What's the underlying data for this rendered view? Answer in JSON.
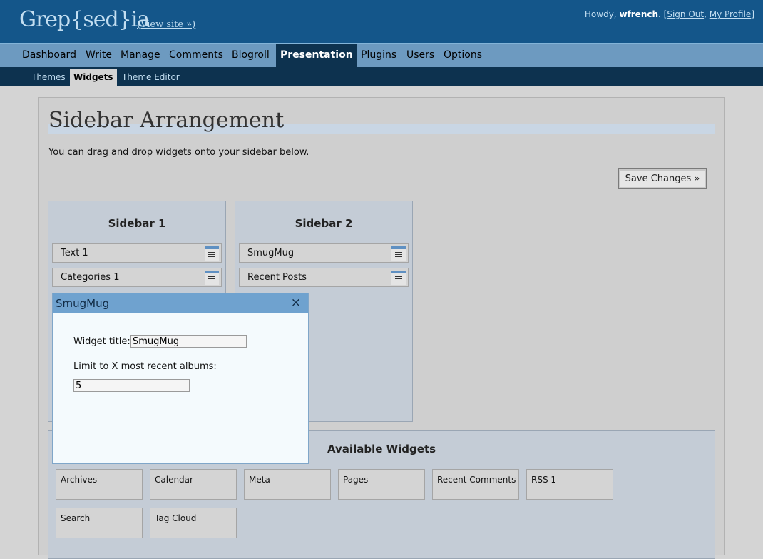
{
  "header": {
    "blog_title": "Grep{sed}ia",
    "view_site": "(View site »)",
    "howdy": "Howdy,",
    "username": "wfrench",
    "sign_out": "Sign Out",
    "my_profile": "My Profile"
  },
  "nav": {
    "items": [
      "Dashboard",
      "Write",
      "Manage",
      "Comments",
      "Blogroll",
      "Presentation",
      "Plugins",
      "Users",
      "Options"
    ],
    "current": "Presentation"
  },
  "subnav": {
    "items": [
      "Themes",
      "Widgets",
      "Theme Editor"
    ],
    "current": "Widgets"
  },
  "main": {
    "title": "Sidebar Arrangement",
    "intro": "You can drag and drop widgets onto your sidebar below.",
    "save_label": "Save Changes »"
  },
  "sidebar1": {
    "title": "Sidebar 1",
    "widgets": [
      "Text 1",
      "Categories 1"
    ]
  },
  "sidebar2": {
    "title": "Sidebar 2",
    "widgets": [
      "SmugMug",
      "Recent Posts"
    ]
  },
  "available": {
    "title": "Available Widgets",
    "widgets": [
      "Archives",
      "Calendar",
      "Meta",
      "Pages",
      "Recent Comments",
      "RSS 1",
      "Search",
      "Tag Cloud"
    ]
  },
  "dialog": {
    "title": "SmugMug",
    "close_icon": "×",
    "title_label": "Widget title:",
    "title_value": "SmugMug",
    "limit_label": "Limit to X most recent albums:",
    "limit_value": "5"
  },
  "colors": {
    "header_bg": "#14568a",
    "nav_bg": "#6d9ac0",
    "subnav_bg": "#0d324f",
    "sidebar_bg": "#c4ccd6",
    "dialog_bar": "#6fa2cf"
  }
}
